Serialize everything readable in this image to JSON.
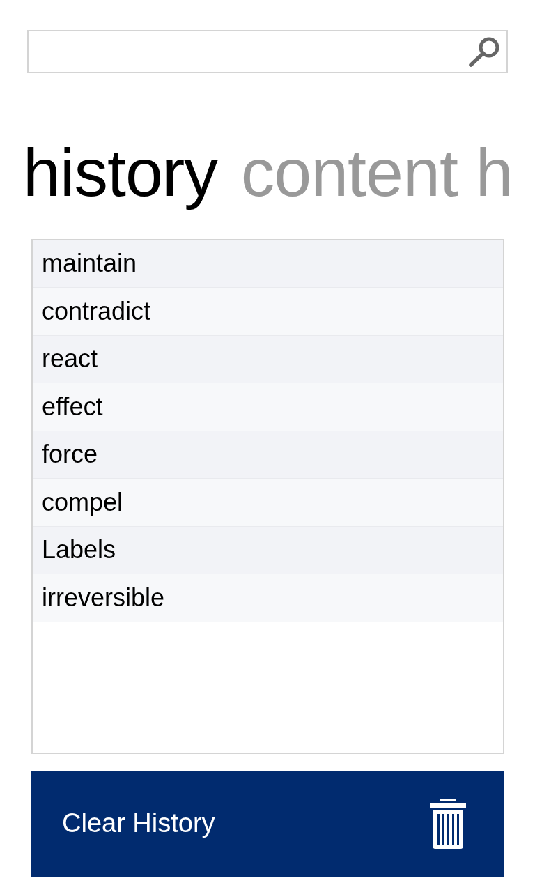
{
  "pivot": [
    {
      "label": "history",
      "selected": true
    },
    {
      "label": "content h",
      "selected": false
    }
  ],
  "history_items": [
    "maintain",
    "contradict",
    "react",
    "effect",
    "force",
    "compel",
    "Labels",
    "irreversible"
  ],
  "clear_button": {
    "label": "Clear History"
  }
}
